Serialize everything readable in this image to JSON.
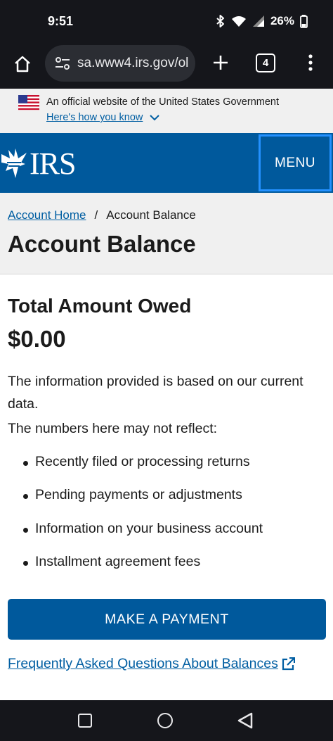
{
  "status_bar": {
    "time": "9:51",
    "battery": "26%",
    "icons": [
      "bluetooth-icon",
      "wifi-icon",
      "signal-icon",
      "battery-icon"
    ]
  },
  "browser": {
    "url": "sa.www4.irs.gov/ol",
    "tab_count": "4"
  },
  "gov_banner": {
    "text": "An official website of the United States Government",
    "link": "Here's how you know"
  },
  "header": {
    "logo": "IRS",
    "menu": "MENU"
  },
  "breadcrumb": {
    "home": "Account Home",
    "separator": "/",
    "current": "Account Balance"
  },
  "page_title": "Account Balance",
  "summary": {
    "title": "Total Amount Owed",
    "amount": "$0.00",
    "info": "The information provided is based on our current data.",
    "reflect": "The numbers here may not reflect:",
    "bullets": [
      "Recently filed or processing returns",
      "Pending payments or adjustments",
      "Information on your business account",
      "Installment agreement fees"
    ]
  },
  "actions": {
    "pay": "MAKE A PAYMENT",
    "faq": "Frequently Asked Questions About Balances"
  },
  "colors": {
    "irs_blue": "#00599c",
    "link_blue": "#005ea2",
    "menu_outline": "#2491ff",
    "banner_gray": "#f0f0f0",
    "system_bar": "#15161b"
  }
}
